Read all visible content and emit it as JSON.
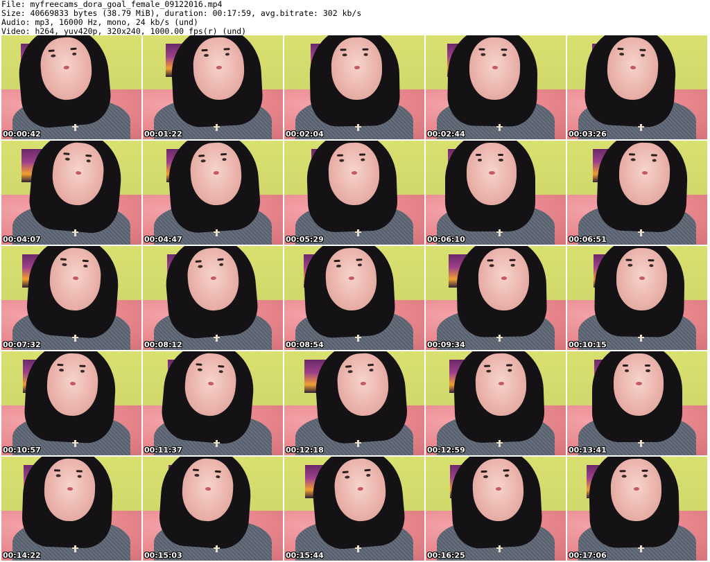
{
  "header": {
    "file": "File: myfreecams_dora_goal_female_09122016.mp4",
    "size": "Size: 40669833 bytes (38.79 MiB), duration: 00:17:59, avg.bitrate: 302 kb/s",
    "audio": "Audio: mp3, 16000 Hz, mono, 24 kb/s (und)",
    "video": "Video: h264, yuv420p, 320x240, 1000.00 fps(r) (und)"
  },
  "colors": {
    "wall": "#d9e070",
    "sofa": "#e7868c",
    "hair": "#141214",
    "shirt": "#5a6270"
  },
  "thumbnails": [
    {
      "time": "00:00:42"
    },
    {
      "time": "00:01:22"
    },
    {
      "time": "00:02:04"
    },
    {
      "time": "00:02:44"
    },
    {
      "time": "00:03:26"
    },
    {
      "time": "00:04:07"
    },
    {
      "time": "00:04:47"
    },
    {
      "time": "00:05:29"
    },
    {
      "time": "00:06:10"
    },
    {
      "time": "00:06:51"
    },
    {
      "time": "00:07:32"
    },
    {
      "time": "00:08:12"
    },
    {
      "time": "00:08:54"
    },
    {
      "time": "00:09:34"
    },
    {
      "time": "00:10:15"
    },
    {
      "time": "00:10:57"
    },
    {
      "time": "00:11:37"
    },
    {
      "time": "00:12:18"
    },
    {
      "time": "00:12:59"
    },
    {
      "time": "00:13:41"
    },
    {
      "time": "00:14:22"
    },
    {
      "time": "00:15:03"
    },
    {
      "time": "00:15:44"
    },
    {
      "time": "00:16:25"
    },
    {
      "time": "00:17:06"
    }
  ]
}
